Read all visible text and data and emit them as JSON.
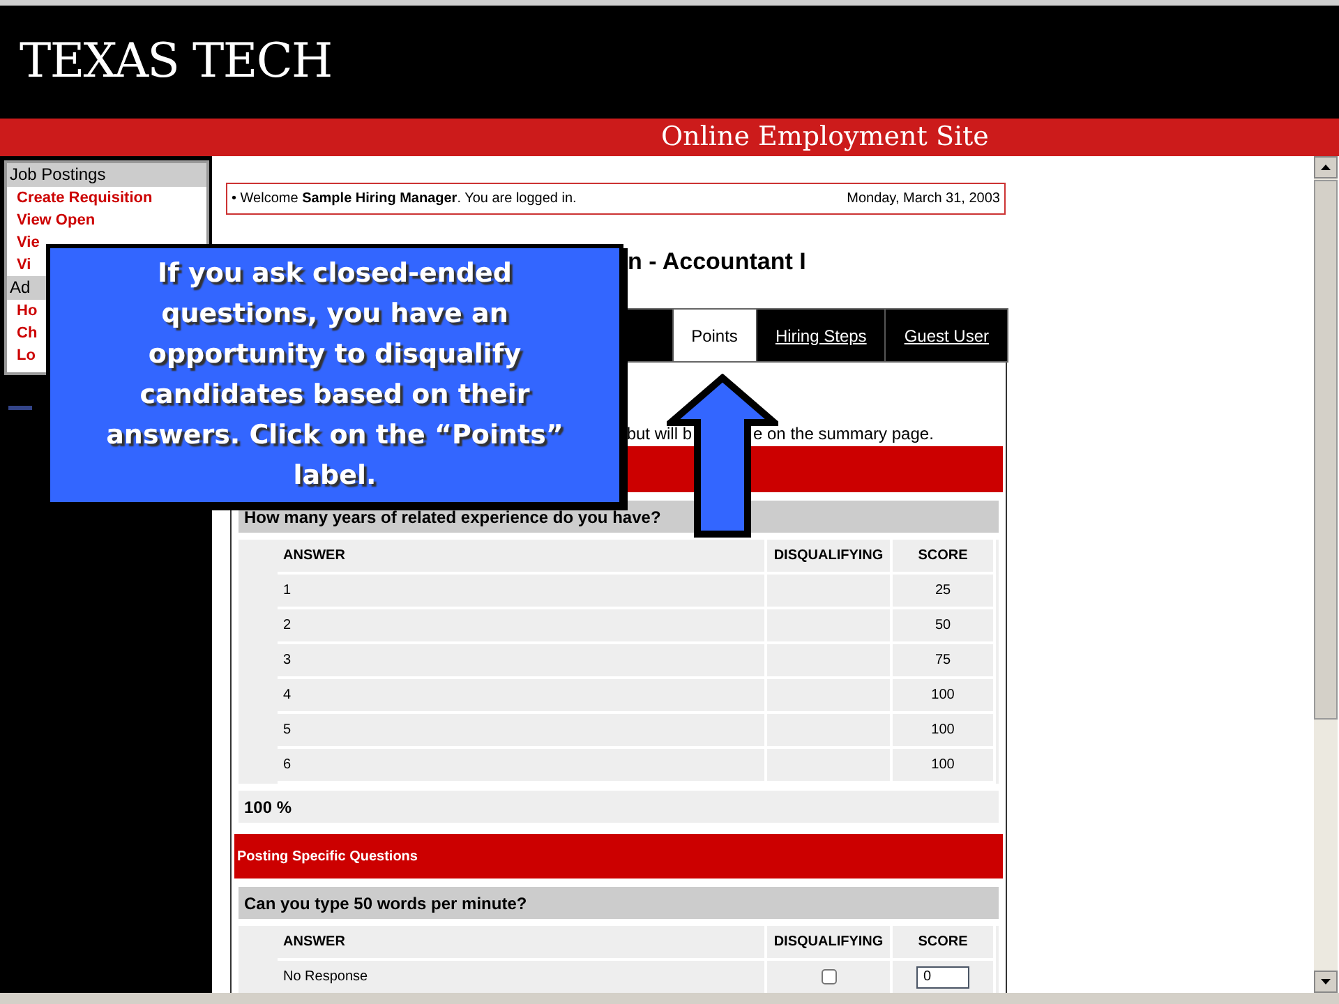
{
  "header": {
    "logo": "TEXAS TECH",
    "site_title": "Online Employment Site"
  },
  "sidebar": {
    "sections": [
      {
        "heading": "Job Postings",
        "items": [
          "Create Requisition",
          "View Open",
          "Vie",
          "Vi"
        ]
      },
      {
        "heading": "Ad",
        "items": [
          "Ho",
          "Ch",
          "Lo"
        ]
      }
    ]
  },
  "welcome": {
    "text": "• Welcome **Sample Hiring Manager**. You are logged in.",
    "date": "Monday, March 31, 2003"
  },
  "page_title": "n - Accountant I",
  "tabs": [
    {
      "label": "Points",
      "selected": true
    },
    {
      "label": "Hiring Steps",
      "selected": false
    },
    {
      "label": "Guest User",
      "selected": false
    }
  ],
  "note_fragments": [
    "but will b",
    "e on the summary page."
  ],
  "sections": [
    {
      "questions": [
        {
          "question": "How many years of related experience do you have?",
          "columns": [
            "ANSWER",
            "DISQUALIFYING",
            "SCORE"
          ],
          "rows": [
            {
              "kind": "plain",
              "answer": "1",
              "score": "25"
            },
            {
              "kind": "plain",
              "answer": "2",
              "score": "50"
            },
            {
              "kind": "plain",
              "answer": "3",
              "score": "75"
            },
            {
              "kind": "plain",
              "answer": "4",
              "score": "100"
            },
            {
              "kind": "plain",
              "answer": "5",
              "score": "100"
            },
            {
              "kind": "plain",
              "answer": "6",
              "score": "100"
            }
          ],
          "total": "100 %"
        }
      ]
    },
    {
      "title": "Posting Specific Questions",
      "questions": [
        {
          "question": "Can you type 50 words per minute?",
          "columns": [
            "ANSWER",
            "DISQUALIFYING",
            "SCORE"
          ],
          "rows": [
            {
              "kind": "input",
              "answer": "No Response",
              "disqualifying": false,
              "score": "0"
            }
          ]
        }
      ]
    }
  ],
  "callout": {
    "text": "If you ask closed-ended questions, you have an opportunity to disqualify candidates based on their answers.  Click on the “Points” label."
  }
}
